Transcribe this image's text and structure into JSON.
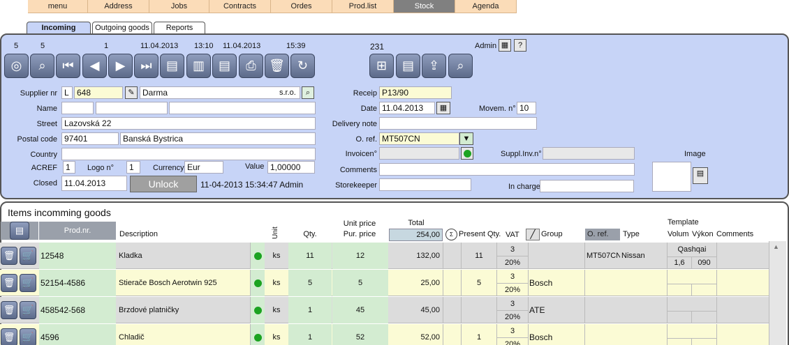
{
  "menu": [
    "menu",
    "Address",
    "Jobs",
    "Contracts",
    "Ordes",
    "Prod.list",
    "Stock",
    "Agenda"
  ],
  "tabs": [
    "Incoming",
    "Outgoing goods",
    "Reports"
  ],
  "status": {
    "n1": "5",
    "n2": "5",
    "n3": "1",
    "date1": "11.04.2013",
    "time1": "13:10",
    "date2": "11.04.2013",
    "time2": "15:39",
    "count": "231",
    "user": "Admin"
  },
  "toolbar_icons": [
    "globe-search-icon",
    "search-icon",
    "first-icon",
    "prev-icon",
    "next-icon",
    "last-icon",
    "new-record-icon",
    "document-icon",
    "add-list-icon",
    "print-icon",
    "delete-icon",
    "refresh-icon"
  ],
  "toolbar2_icons": [
    "tree-icon",
    "documents-icon",
    "export-icon",
    "zoom-icon"
  ],
  "supplier": {
    "supplier_nr_label": "Supplier nr",
    "type": "L",
    "nr": "648",
    "name": "Darma",
    "legal": "s.r.o.",
    "name_label": "Name",
    "street_label": "Street",
    "street": "Lazovská 22",
    "postal_label": "Postal code",
    "postal": "97401",
    "city": "Banská Bystrica",
    "country_label": "Country",
    "country": "",
    "acref_label": "ACREF",
    "acref": "1",
    "logo_label": "Logo n°",
    "logo": "1",
    "currency_label": "Currency",
    "currency": "Eur",
    "value_label": "Value",
    "value": "1,00000",
    "closed_label": "Closed",
    "closed": "11.04.2013",
    "unlock": "Unlock",
    "closed_info": "11-04-2013 15:34:47 Admin"
  },
  "receipt": {
    "receip_label": "Receip",
    "receip": "P13/90",
    "date_label": "Date",
    "date": "11.04.2013",
    "movem_label": "Movem. n°",
    "movem": "10",
    "delivery_label": "Delivery note",
    "delivery": "",
    "oref_label": "O. ref.",
    "oref": "MT507CN",
    "invoicen_label": "Invoicen°",
    "suppl_label": "Suppl.Inv.n°",
    "comments_label": "Comments",
    "storekeeper_label": "Storekeeper",
    "incharge_label": "In charge",
    "image_label": "Image"
  },
  "items": {
    "title": "Items incomming goods",
    "headers": {
      "prodnr": "Prod.nr.",
      "description": "Description",
      "unit": "Unit",
      "qty": "Qty.",
      "unit_price": "Unit price",
      "pur_price": "Pur. price",
      "total": "Total",
      "total_value": "254,00",
      "present_qty": "Present Qty.",
      "vat": "VAT",
      "group": "Group",
      "oref": "O. ref.",
      "type": "Type",
      "template": "Template",
      "volum": "Volum",
      "vykon": "Výkon",
      "comments": "Comments"
    },
    "rows": [
      {
        "prodnr": "12548",
        "description": "Kladka",
        "unit": "ks",
        "qty": "11",
        "price": "12",
        "total": "132,00",
        "present": "11",
        "vat_code": "3",
        "vat": "20%",
        "group": "",
        "oref": "MT507CN",
        "type": "Nissan",
        "tpl_name": "Qashqai",
        "tpl_volum": "1,6",
        "tpl_vykon": "090"
      },
      {
        "prodnr": "52154-4586",
        "description": "Stierače Bosch Aerotwin 925",
        "unit": "ks",
        "qty": "5",
        "price": "5",
        "total": "25,00",
        "present": "5",
        "vat_code": "3",
        "vat": "20%",
        "group": "Bosch",
        "oref": "",
        "type": "",
        "tpl_name": "",
        "tpl_volum": "",
        "tpl_vykon": ""
      },
      {
        "prodnr": "458542-568",
        "description": "Brzdové platničky",
        "unit": "ks",
        "qty": "1",
        "price": "45",
        "total": "45,00",
        "present": "",
        "vat_code": "3",
        "vat": "20%",
        "group": "ATE",
        "oref": "",
        "type": "",
        "tpl_name": "",
        "tpl_volum": "",
        "tpl_vykon": ""
      },
      {
        "prodnr": "4596",
        "description": "Chladič",
        "unit": "ks",
        "qty": "1",
        "price": "52",
        "total": "52,00",
        "present": "1",
        "vat_code": "3",
        "vat": "20%",
        "group": "Bosch",
        "oref": "",
        "type": "",
        "tpl_name": "",
        "tpl_volum": "",
        "tpl_vykon": ""
      }
    ]
  }
}
